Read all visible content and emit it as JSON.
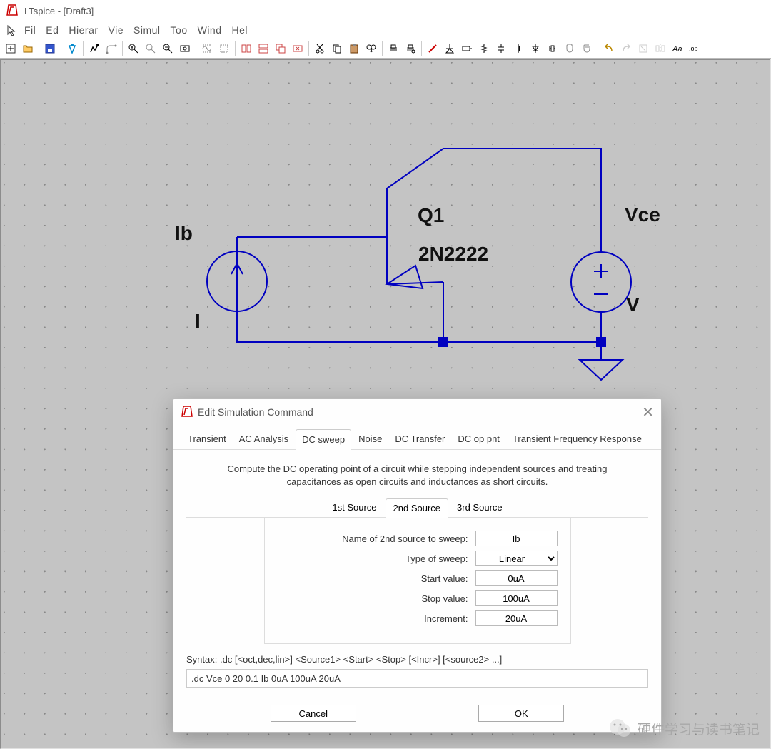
{
  "app": {
    "title": "LTspice - [Draft3]"
  },
  "menu": [
    "Fil",
    "Ed",
    "Hierar",
    "Vie",
    "Simul",
    "Too",
    "Wind",
    "Hel"
  ],
  "schematic": {
    "current_source": {
      "name": "Ib",
      "value": "I"
    },
    "transistor": {
      "name": "Q1",
      "model": "2N2222"
    },
    "voltage_source": {
      "name": "Vce",
      "value": "V"
    }
  },
  "dialog": {
    "title": "Edit Simulation Command",
    "tabs": [
      "Transient",
      "AC Analysis",
      "DC sweep",
      "Noise",
      "DC Transfer",
      "DC op pnt",
      "Transient Frequency Response"
    ],
    "active_tab": "DC sweep",
    "description": "Compute the DC operating point of a circuit while stepping independent sources and treating capacitances as open circuits and inductances as short circuits.",
    "source_tabs": [
      "1st Source",
      "2nd Source",
      "3rd Source"
    ],
    "active_source_tab": "2nd Source",
    "fields": {
      "source_name_label": "Name of 2nd source to sweep:",
      "source_name_value": "Ib",
      "sweep_type_label": "Type of sweep:",
      "sweep_type_value": "Linear",
      "start_label": "Start value:",
      "start_value": "0uA",
      "stop_label": "Stop value:",
      "stop_value": "100uA",
      "incr_label": "Increment:",
      "incr_value": "20uA"
    },
    "syntax_label": "Syntax:   .dc [<oct,dec,lin>] <Source1> <Start> <Stop> [<Incr>] [<source2> ...]",
    "cmd_value": ".dc Vce 0 20 0.1 Ib 0uA 100uA 20uA",
    "cancel_label": "Cancel",
    "ok_label": "OK"
  },
  "watermark": "硬件学习与读书笔记"
}
